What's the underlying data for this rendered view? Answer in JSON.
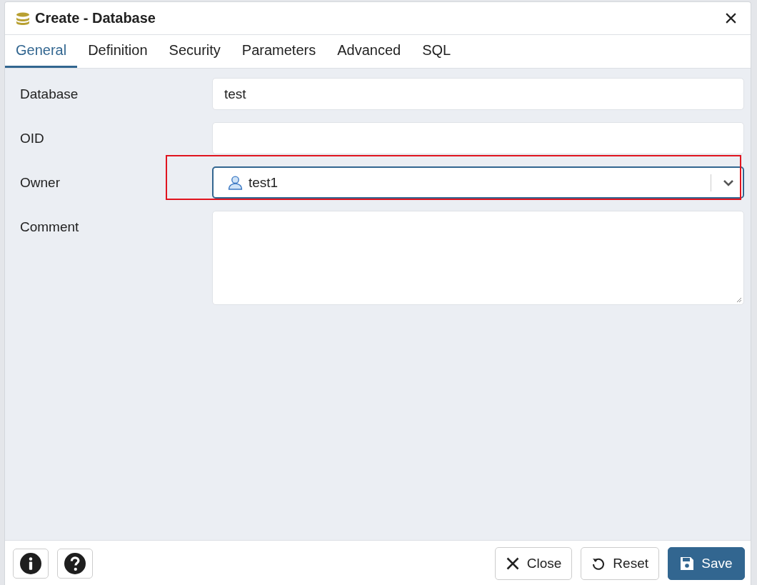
{
  "dialog": {
    "title": "Create - Database"
  },
  "tabs": [
    {
      "label": "General",
      "selected": true
    },
    {
      "label": "Definition",
      "selected": false
    },
    {
      "label": "Security",
      "selected": false
    },
    {
      "label": "Parameters",
      "selected": false
    },
    {
      "label": "Advanced",
      "selected": false
    },
    {
      "label": "SQL",
      "selected": false
    }
  ],
  "fields": [
    {
      "kind": "text",
      "label": "Database",
      "value": "test",
      "highlighted": false
    },
    {
      "kind": "text",
      "label": "OID",
      "highlighted": false
    },
    {
      "kind": "select",
      "label": "Owner",
      "value": "test1",
      "focused": true,
      "highlighted": true
    },
    {
      "kind": "textarea",
      "label": "Comment",
      "highlighted": false
    }
  ],
  "footer": {
    "left_buttons": [
      {
        "kind": "info"
      },
      {
        "kind": "help"
      }
    ],
    "buttons": [
      {
        "kind": "close",
        "label": "Close",
        "primary": false
      },
      {
        "kind": "reset",
        "label": "Reset",
        "primary": false
      },
      {
        "kind": "save",
        "label": "Save",
        "primary": true
      }
    ]
  }
}
